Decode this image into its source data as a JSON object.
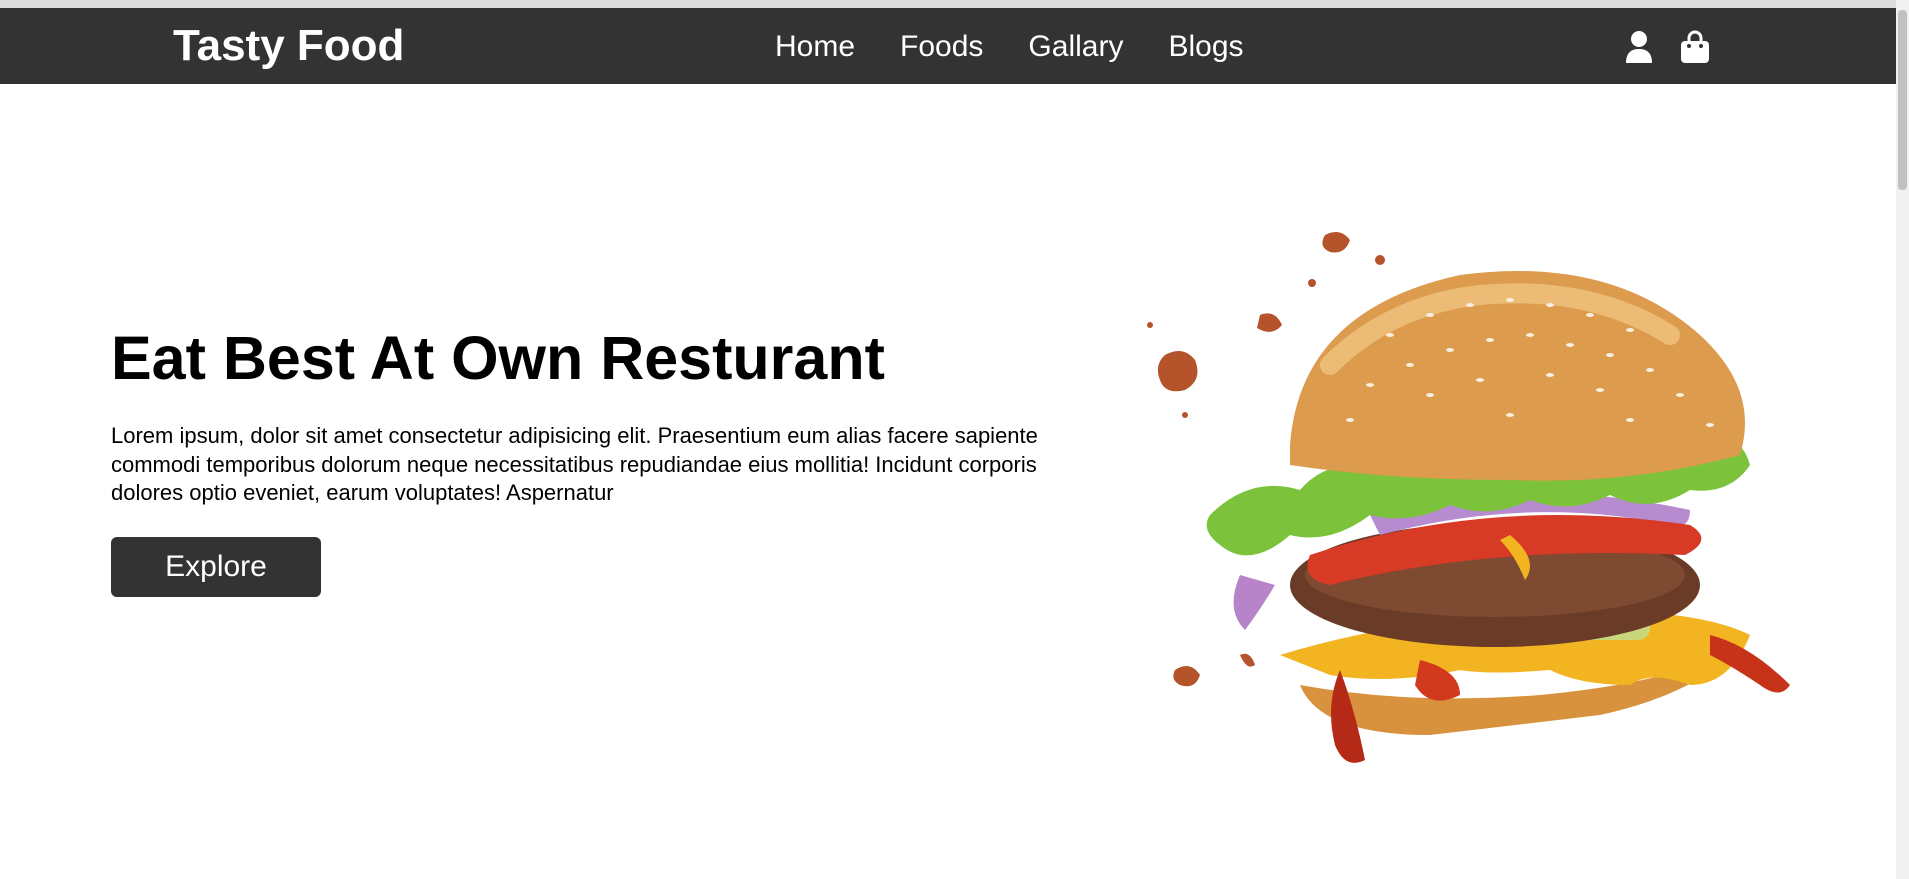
{
  "header": {
    "logo": "Tasty Food",
    "nav": [
      {
        "label": "Home"
      },
      {
        "label": "Foods"
      },
      {
        "label": "Gallary"
      },
      {
        "label": "Blogs"
      }
    ],
    "icons": [
      "user-icon",
      "shopping-bag-icon"
    ]
  },
  "hero": {
    "title": "Eat Best At Own Resturant",
    "description": "Lorem ipsum, dolor sit amet consectetur adipisicing elit. Praesentium eum alias facere sapiente commodi temporibus dolorum neque necessitatibus repudiandae eius mollitia! Incidunt corporis dolores optio eveniet, earum voluptates! Aspernatur",
    "button_label": "Explore",
    "image": "burger-image"
  },
  "colors": {
    "navbar": "#333333",
    "button": "#333333",
    "text": "#000000",
    "background": "#ffffff"
  }
}
